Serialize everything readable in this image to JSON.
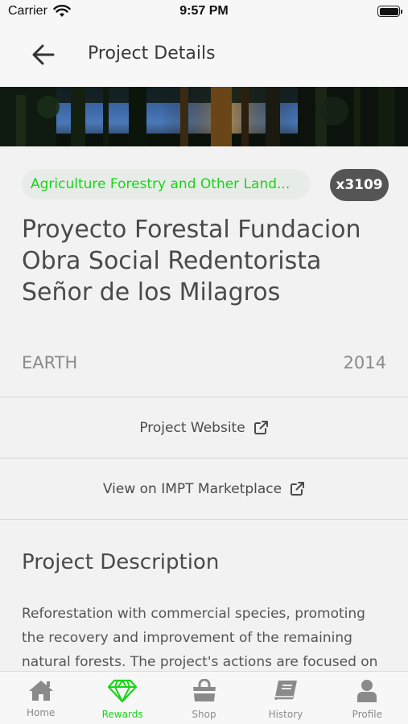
{
  "status_bar": {
    "carrier": "Carrier",
    "time": "9:57 PM"
  },
  "header": {
    "title": "Project Details",
    "back_icon": "arrow-left-icon"
  },
  "project": {
    "category": "Agriculture Forestry and Other Land...",
    "count": "x3109",
    "name": "Proyecto Forestal Fundacion Obra Social Redentorista Señor de los Milagros",
    "origin": "EARTH",
    "year": "2014"
  },
  "links": {
    "website_label": "Project Website",
    "marketplace_label": "View on IMPT Marketplace",
    "icon": "external-link-icon"
  },
  "description": {
    "title": "Project Description",
    "text": "Reforestation with commercial species, promoting the recovery and improvement of the remaining natural forests. The project's actions are focused on"
  },
  "tabs": [
    {
      "label": "Home",
      "icon": "home-icon",
      "active": false
    },
    {
      "label": "Rewards",
      "icon": "diamond-icon",
      "active": true
    },
    {
      "label": "Shop",
      "icon": "shopping-bag-icon",
      "active": false
    },
    {
      "label": "History",
      "icon": "book-icon",
      "active": false
    },
    {
      "label": "Profile",
      "icon": "user-icon",
      "active": false
    }
  ],
  "colors": {
    "accent": "#19d419",
    "badge": "#555555",
    "text": "#4a4a4a",
    "muted": "#8a8a8a"
  }
}
